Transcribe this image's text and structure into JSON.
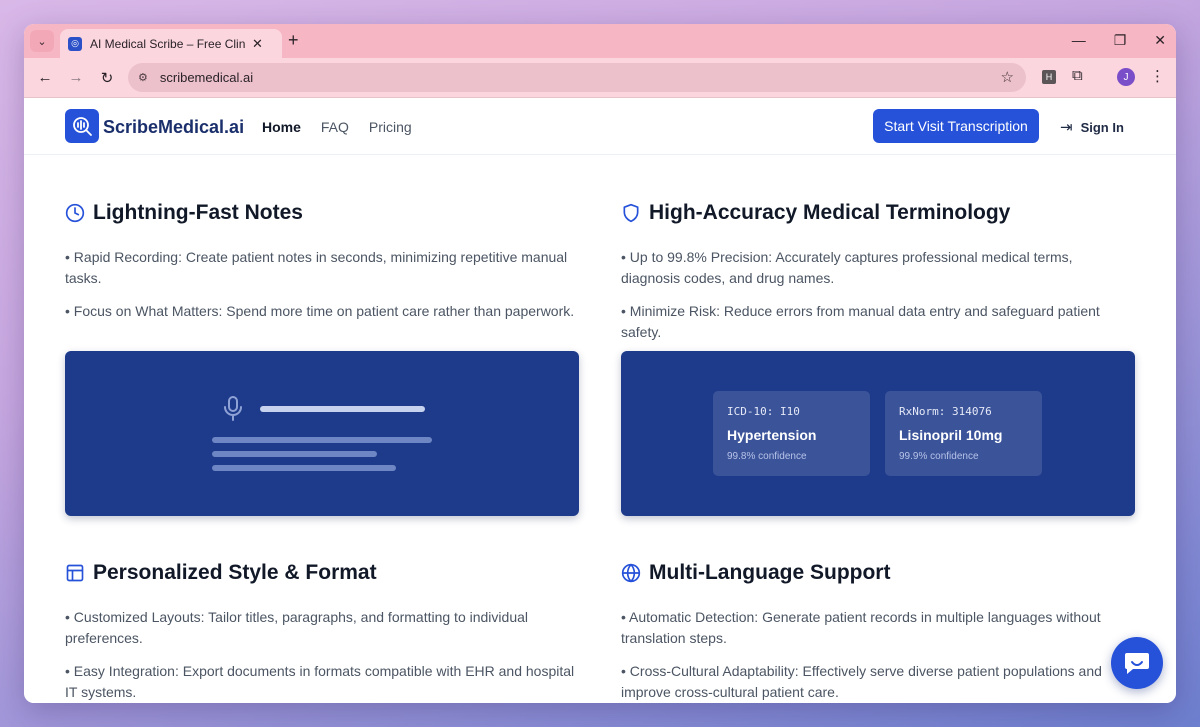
{
  "browser": {
    "tab_title": "AI Medical Scribe – Free Clinical",
    "tab_close": "✕",
    "new_tab": "+",
    "url": "scribemedical.ai",
    "ext_h": "H",
    "profile_initial": "J"
  },
  "header": {
    "brand": "ScribeMedical.ai",
    "nav": [
      {
        "label": "Home"
      },
      {
        "label": "FAQ"
      },
      {
        "label": "Pricing"
      }
    ],
    "cta_label": "Start Visit Transcription",
    "signin_label": "Sign In"
  },
  "features": [
    {
      "title": "Lightning-Fast Notes",
      "icon": "clock-icon",
      "bullets": [
        "• Rapid Recording: Create patient notes in seconds, minimizing repetitive manual tasks.",
        "• Focus on What Matters: Spend more time on patient care rather than paperwork."
      ]
    },
    {
      "title": "High-Accuracy Medical Terminology",
      "icon": "shield-icon",
      "bullets": [
        "• Up to 99.8% Precision: Accurately captures professional medical terms, diagnosis codes, and drug names.",
        "• Minimize Risk: Reduce errors from manual data entry and safeguard patient safety."
      ]
    },
    {
      "title": "Personalized Style & Format",
      "icon": "layout-icon",
      "bullets": [
        "• Customized Layouts: Tailor titles, paragraphs, and formatting to individual preferences.",
        "• Easy Integration: Export documents in formats compatible with EHR and hospital IT systems."
      ]
    },
    {
      "title": "Multi-Language Support",
      "icon": "globe-icon",
      "bullets": [
        "• Automatic Detection: Generate patient records in multiple languages without translation steps.",
        "• Cross-Cultural Adaptability: Effectively serve diverse patient populations and improve cross-cultural patient care."
      ]
    }
  ],
  "terminology_cards": [
    {
      "code": "ICD-10: I10",
      "term": "Hypertension",
      "confidence": "99.8% confidence"
    },
    {
      "code": "RxNorm: 314076",
      "term": "Lisinopril 10mg",
      "confidence": "99.9% confidence"
    }
  ],
  "colors": {
    "brand": "#2652d9",
    "panel": "#1e3a8a",
    "tab_strip": "#f7b6c4"
  }
}
